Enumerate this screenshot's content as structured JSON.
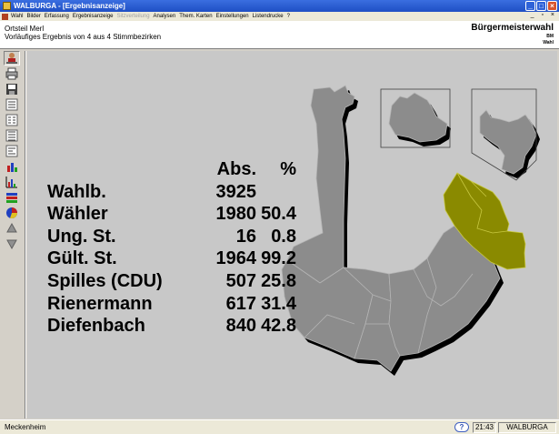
{
  "window": {
    "title": "WALBURGA - [Ergebnisanzeige]",
    "buttons": [
      "_",
      "□",
      "×"
    ]
  },
  "menu": {
    "items": [
      {
        "label": "Wahl",
        "enabled": true
      },
      {
        "label": "Bilder",
        "enabled": true
      },
      {
        "label": "Erfassung",
        "enabled": true
      },
      {
        "label": "Ergebnisanzeige",
        "enabled": true
      },
      {
        "label": "Sitzverteilung",
        "enabled": false
      },
      {
        "label": "Analysen",
        "enabled": true
      },
      {
        "label": "Them. Karten",
        "enabled": true
      },
      {
        "label": "Einstellungen",
        "enabled": true
      },
      {
        "label": "Listendrucke",
        "enabled": true
      },
      {
        "label": "?",
        "enabled": true
      }
    ],
    "mdi_buttons": "_ ▫ ×"
  },
  "header": {
    "ortsteil": "Ortsteil Merl",
    "status": "Vorläufiges Ergebnis von 4 aus 4 Stimmbezirken",
    "election_title": "Bürgermeisterwahl",
    "election_short": "BM Wahl"
  },
  "toolbar": {
    "tools": [
      "person-icon",
      "printer-icon",
      "save-icon",
      "district-list-icon",
      "district-list-2-icon",
      "district-list-3-icon",
      "district-list-4-icon",
      "bar-chart-icon",
      "bar-chart-2-icon",
      "stacked-bars-icon",
      "pie-chart-icon",
      "arrow-up-icon",
      "arrow-down-icon"
    ]
  },
  "results": {
    "header_abs": "Abs.",
    "header_pct": "%",
    "rows": [
      {
        "label": "Wahlb.",
        "abs": "3925",
        "pct": ""
      },
      {
        "label": "Wähler",
        "abs": "1980",
        "pct": "50.4"
      },
      {
        "label": "Ung. St.",
        "abs": "16",
        "pct": "0.8"
      },
      {
        "label": "Gült. St.",
        "abs": "1964",
        "pct": "99.2"
      },
      {
        "label": "Spilles (CDU)",
        "abs": "507",
        "pct": "25.8"
      },
      {
        "label": "Rienermann",
        "abs": "617",
        "pct": "31.4"
      },
      {
        "label": "Diefenbach",
        "abs": "840",
        "pct": "42.8"
      }
    ]
  },
  "map": {
    "district_color": "#8c8c8c",
    "highlight_color": "#8a8a00",
    "shadow_color": "#000000",
    "background": "#c8c8c8"
  },
  "statusbar": {
    "place": "Meckenheim",
    "help": "?",
    "time": "21:43",
    "app": "WALBURGA"
  }
}
